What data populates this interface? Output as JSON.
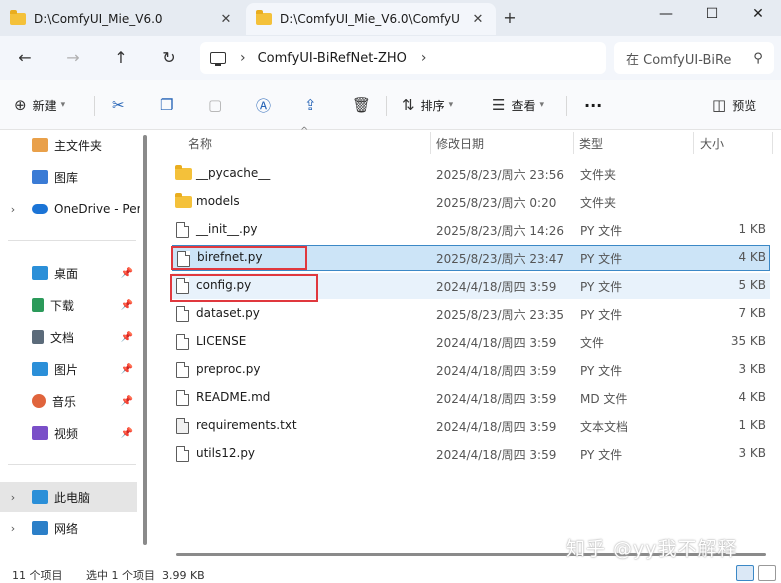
{
  "tabs": [
    {
      "title": "D:\\ComfyUI_Mie_V6.0",
      "active": false
    },
    {
      "title": "D:\\ComfyUI_Mie_V6.0\\ComfyU",
      "active": true
    }
  ],
  "window": {
    "minimize": "—",
    "maximize": "☐",
    "close": "✕",
    "new_tab": "+"
  },
  "nav": {
    "back": "←",
    "forward": "→",
    "up": "↑",
    "refresh": "↻"
  },
  "address": {
    "chevron": "›",
    "crumb": "ComfyUI-BiRefNet-ZHO",
    "end_chevron": "›"
  },
  "search": {
    "placeholder": "在 ComfyUI-BiRe"
  },
  "toolbar": {
    "new_label": "新建",
    "sort_label": "排序",
    "view_label": "查看",
    "more_label": "···",
    "preview_label": "预览"
  },
  "sidebar": {
    "items": [
      {
        "label": "主文件夹",
        "icon": "home-icon",
        "color": "#e9a04a"
      },
      {
        "label": "图库",
        "icon": "gallery-icon",
        "color": "#3a7bd5"
      },
      {
        "label": "OneDrive - Per",
        "icon": "cloud-icon",
        "color": "#1b74d6"
      },
      {
        "label": "桌面",
        "icon": "desktop-icon",
        "color": "#2b8fd8"
      },
      {
        "label": "下载",
        "icon": "download-icon",
        "color": "#2b9a5a"
      },
      {
        "label": "文档",
        "icon": "document-icon",
        "color": "#5b6b7a"
      },
      {
        "label": "图片",
        "icon": "pictures-icon",
        "color": "#2b8fd8"
      },
      {
        "label": "音乐",
        "icon": "music-icon",
        "color": "#e0643c"
      },
      {
        "label": "视频",
        "icon": "video-icon",
        "color": "#7a4fc8"
      },
      {
        "label": "此电脑",
        "icon": "pc-icon",
        "color": "#2b8fd8"
      },
      {
        "label": "网络",
        "icon": "network-icon",
        "color": "#2b7fc8"
      }
    ],
    "expand": "›"
  },
  "columns": {
    "name": "名称",
    "modified": "修改日期",
    "type": "类型",
    "size": "大小"
  },
  "files": [
    {
      "name": "__pycache__",
      "modified": "2025/8/23/周六 23:56",
      "type": "文件夹",
      "size": "",
      "kind": "folder"
    },
    {
      "name": "models",
      "modified": "2025/8/23/周六 0:20",
      "type": "文件夹",
      "size": "",
      "kind": "folder"
    },
    {
      "name": "__init__.py",
      "modified": "2025/8/23/周六 14:26",
      "type": "PY 文件",
      "size": "1 KB",
      "kind": "file"
    },
    {
      "name": "birefnet.py",
      "modified": "2025/8/23/周六 23:47",
      "type": "PY 文件",
      "size": "4 KB",
      "kind": "file"
    },
    {
      "name": "config.py",
      "modified": "2024/4/18/周四 3:59",
      "type": "PY 文件",
      "size": "5 KB",
      "kind": "file"
    },
    {
      "name": "dataset.py",
      "modified": "2025/8/23/周六 23:35",
      "type": "PY 文件",
      "size": "7 KB",
      "kind": "file"
    },
    {
      "name": "LICENSE",
      "modified": "2024/4/18/周四 3:59",
      "type": "文件",
      "size": "35 KB",
      "kind": "file"
    },
    {
      "name": "preproc.py",
      "modified": "2024/4/18/周四 3:59",
      "type": "PY 文件",
      "size": "3 KB",
      "kind": "file"
    },
    {
      "name": "README.md",
      "modified": "2024/4/18/周四 3:59",
      "type": "MD 文件",
      "size": "4 KB",
      "kind": "file"
    },
    {
      "name": "requirements.txt",
      "modified": "2024/4/18/周四 3:59",
      "type": "文本文档",
      "size": "1 KB",
      "kind": "file"
    },
    {
      "name": "utils12.py",
      "modified": "2024/4/18/周四 3:59",
      "type": "PY 文件",
      "size": "3 KB",
      "kind": "file"
    }
  ],
  "status": {
    "count": "11 个项目",
    "selection": "选中 1 个项目  3.99 KB"
  },
  "watermark": "知乎 @yy我不解释",
  "colors": {
    "accent": "#2563b6",
    "highlight": "#e0383e",
    "selection": "#cce4f7"
  }
}
